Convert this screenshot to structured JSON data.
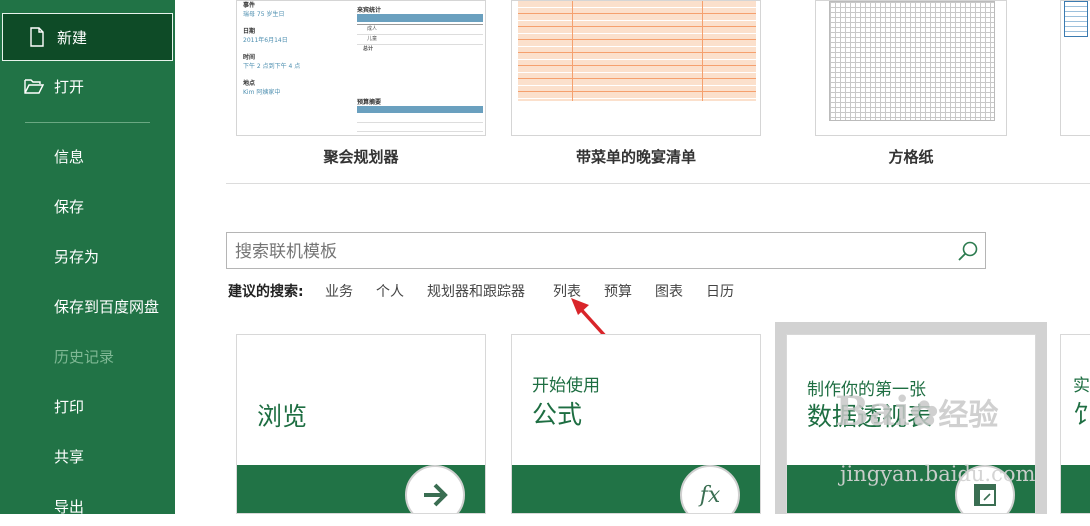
{
  "sidebar": {
    "items": [
      {
        "label": "新建",
        "icon": "new-document-icon",
        "selected": true
      },
      {
        "label": "打开",
        "icon": "folder-open-icon"
      },
      {
        "label": "信息"
      },
      {
        "label": "保存"
      },
      {
        "label": "另存为"
      },
      {
        "label": "保存到百度网盘"
      },
      {
        "label": "历史记录",
        "disabled": true
      },
      {
        "label": "打印"
      },
      {
        "label": "共享"
      },
      {
        "label": "导出"
      }
    ]
  },
  "featured_templates": [
    {
      "title": "聚会规划器",
      "preview": {
        "left": [
          "事件",
          "瑞母 75 岁生日",
          "日期",
          "2011年6月14日",
          "时间",
          "下午 2 点到下午 4 点",
          "地点",
          "Kim 阿姨家中"
        ],
        "guest_title": "来宾统计",
        "guest_rows": [
          "成人",
          "儿童",
          "总计"
        ],
        "budget_title": "预算摘要"
      }
    },
    {
      "title": "带菜单的晚宴清单"
    },
    {
      "title": "方格纸"
    }
  ],
  "search": {
    "placeholder": "搜索联机模板",
    "value": ""
  },
  "suggestions": {
    "label": "建议的搜索:",
    "items": [
      "业务",
      "个人",
      "规划器和跟踪器",
      "列表",
      "预算",
      "图表",
      "日历"
    ]
  },
  "cards": [
    {
      "line1": "",
      "line2": "浏览",
      "icon": "arrow-right-icon"
    },
    {
      "line1": "开始使用",
      "line2": "公式",
      "icon": "fx-icon"
    },
    {
      "line1": "制作你的第一张",
      "line2": "数据透视表",
      "icon": "pivot-table-icon"
    },
    {
      "line1": "实",
      "line2": "饣"
    }
  ],
  "watermark": {
    "brand": "Bai",
    "brand2": "经验",
    "url": "jingyan.baidu.com"
  },
  "colors": {
    "excel_green": "#217346",
    "selected_bg": "#0e4b27",
    "annotation_arrow": "#d9252a"
  }
}
